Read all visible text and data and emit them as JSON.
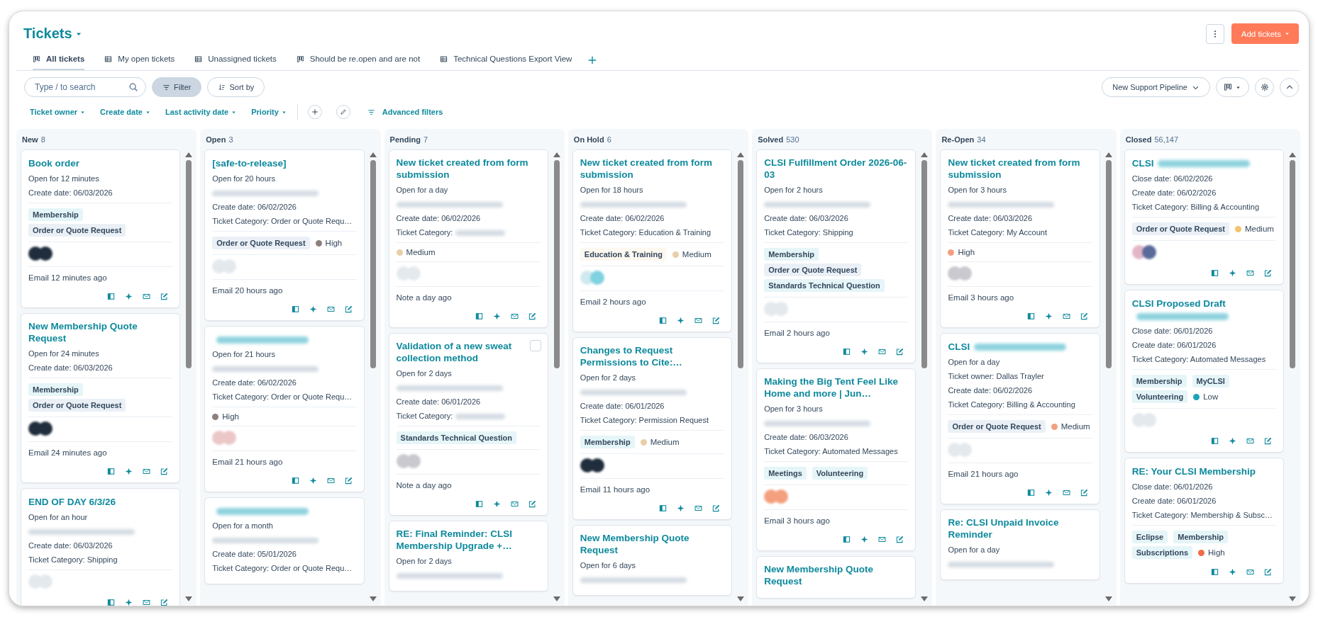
{
  "header": {
    "title": "Tickets",
    "add_button": "Add tickets"
  },
  "tabs": [
    {
      "label": "All tickets",
      "kind": "board",
      "selected": true
    },
    {
      "label": "My open tickets",
      "kind": "table",
      "selected": false
    },
    {
      "label": "Unassigned tickets",
      "kind": "table",
      "selected": false
    },
    {
      "label": "Should be re.open and are not",
      "kind": "board",
      "selected": false
    },
    {
      "label": "Technical Questions Export View",
      "kind": "table",
      "selected": false
    }
  ],
  "toolbar": {
    "search": {
      "placeholder": "Type / to search"
    },
    "filter": {
      "label": "Filter",
      "active": true
    },
    "sort": "Sort by",
    "pipeline": "New Support Pipeline"
  },
  "filters": [
    "Ticket owner",
    "Create date",
    "Last activity date",
    "Priority"
  ],
  "advanced_filters": "Advanced filters",
  "columns": [
    {
      "name": "New",
      "count": "8",
      "cards": [
        {
          "title": "Book order",
          "details": [
            {
              "kind": "text",
              "text": "Open for 12 minutes"
            },
            {
              "kind": "text",
              "text": "Create date: 06/03/2026"
            }
          ],
          "tags": [
            {
              "label": "Membership",
              "color": "#e5f5f8"
            },
            {
              "label": "Order or Quote Request",
              "color": "#eaf0f6"
            }
          ],
          "contact": {
            "kind": "dark"
          },
          "activity": "Email 12 minutes ago"
        },
        {
          "title": "New Membership Quote Request",
          "details": [
            {
              "kind": "text",
              "text": "Open for 24 minutes"
            },
            {
              "kind": "text",
              "text": "Create date: 06/03/2026"
            }
          ],
          "tags": [
            {
              "label": "Membership",
              "color": "#e5f5f8"
            },
            {
              "label": "Order or Quote Request",
              "color": "#eaf0f6"
            }
          ],
          "contact": {
            "kind": "dark"
          },
          "activity": "Email 24 minutes ago"
        },
        {
          "title": "END OF DAY 6/3/26",
          "details": [
            {
              "kind": "text",
              "text": "Open for an hour"
            },
            {
              "kind": "redacted"
            },
            {
              "kind": "text",
              "text": "Create date: 06/03/2026"
            },
            {
              "kind": "text",
              "text": "Ticket Category: Shipping"
            }
          ],
          "contact": {
            "kind": "light"
          }
        }
      ]
    },
    {
      "name": "Open",
      "count": "3",
      "cards": [
        {
          "title": "[safe-to-release]",
          "details": [
            {
              "kind": "text",
              "text": "Open for 20 hours"
            },
            {
              "kind": "redacted"
            },
            {
              "kind": "text",
              "text": "Create date: 06/02/2026"
            },
            {
              "kind": "text",
              "text": "Ticket Category: Order or Quote Requ…"
            }
          ],
          "tags": [
            {
              "label": "Order or Quote Request",
              "color": "#eaf0f6"
            }
          ],
          "priority": {
            "label": "High",
            "color": "#8c8080"
          },
          "contact": {
            "kind": "light"
          },
          "activity": "Email 20 hours ago"
        },
        {
          "title_blur": true,
          "details": [
            {
              "kind": "text",
              "text": "Open for 21 hours"
            },
            {
              "kind": "redacted"
            },
            {
              "kind": "text",
              "text": "Create date: 06/02/2026"
            },
            {
              "kind": "text",
              "text": "Ticket Category: Order or Quote Requ…"
            }
          ],
          "priority": {
            "label": "High",
            "color": "#8c8080"
          },
          "contact": {
            "kind": "pink"
          },
          "activity": "Email 21 hours ago"
        },
        {
          "title_blur": true,
          "details": [
            {
              "kind": "text",
              "text": "Open for a month"
            },
            {
              "kind": "redacted"
            },
            {
              "kind": "text",
              "text": "Create date: 05/01/2026"
            },
            {
              "kind": "text",
              "text": "Ticket Category: Order or Quote Requ…"
            }
          ]
        }
      ]
    },
    {
      "name": "Pending",
      "count": "7",
      "cards": [
        {
          "title": "New ticket created from form submission",
          "details": [
            {
              "kind": "text",
              "text": "Open for a day"
            },
            {
              "kind": "redacted"
            },
            {
              "kind": "text",
              "text": "Create date: 06/02/2026"
            },
            {
              "kind": "partial",
              "text": "Ticket Category:"
            }
          ],
          "priority": {
            "label": "Medium",
            "color": "#e8cfa8"
          },
          "contact": {
            "kind": "light"
          },
          "activity": "Note a day ago"
        },
        {
          "title": "Validation of a new sweat collection method",
          "checked": false,
          "details": [
            {
              "kind": "text",
              "text": "Open for 2 days"
            },
            {
              "kind": "redacted"
            },
            {
              "kind": "text",
              "text": "Create date: 06/01/2026"
            },
            {
              "kind": "partial",
              "text": "Ticket Category:"
            }
          ],
          "tags": [
            {
              "label": "Standards Technical Question",
              "color": "#e5f5f8"
            }
          ],
          "contact": {
            "kind": "grey"
          },
          "activity": "Note a day ago"
        },
        {
          "title": "RE: Final Reminder: CLSI Membership Upgrade +…",
          "details": [
            {
              "kind": "text",
              "text": "Open for 2 days"
            },
            {
              "kind": "redacted"
            }
          ]
        }
      ]
    },
    {
      "name": "On Hold",
      "count": "6",
      "cards": [
        {
          "title": "New ticket created from form submission",
          "details": [
            {
              "kind": "text",
              "text": "Open for 18 hours"
            },
            {
              "kind": "redacted"
            },
            {
              "kind": "text",
              "text": "Create date: 06/02/2026"
            },
            {
              "kind": "text",
              "text": "Ticket Category: Education & Training"
            }
          ],
          "tags": [
            {
              "label": "Education & Training",
              "color": "#fdf8f0"
            }
          ],
          "priority": {
            "label": "Medium",
            "color": "#e8cfa8"
          },
          "contact": {
            "kind": "teal"
          },
          "activity": "Email 2 hours ago"
        },
        {
          "title": "Changes to Request Permissions to Cite:…",
          "details": [
            {
              "kind": "text",
              "text": "Open for 2 days"
            },
            {
              "kind": "redacted"
            },
            {
              "kind": "text",
              "text": "Create date: 06/01/2026"
            },
            {
              "kind": "text",
              "text": "Ticket Category: Permission Request"
            }
          ],
          "tags": [
            {
              "label": "Membership",
              "color": "#e5f5f8"
            }
          ],
          "priority": {
            "label": "Medium",
            "color": "#e8cfa8"
          },
          "contact": {
            "kind": "dark"
          },
          "activity": "Email 11 hours ago"
        },
        {
          "title": "New Membership Quote Request",
          "details": [
            {
              "kind": "text",
              "text": "Open for 6 days"
            },
            {
              "kind": "redacted"
            }
          ]
        }
      ]
    },
    {
      "name": "Solved",
      "count": "530",
      "cards": [
        {
          "title": "CLSI Fulfillment Order 2026-06-03",
          "details": [
            {
              "kind": "text",
              "text": "Open for 2 hours"
            },
            {
              "kind": "redacted"
            },
            {
              "kind": "text",
              "text": "Create date: 06/03/2026"
            },
            {
              "kind": "text",
              "text": "Ticket Category: Shipping"
            }
          ],
          "tags": [
            {
              "label": "Membership",
              "color": "#e5f5f8"
            },
            {
              "label": "Order or Quote Request",
              "color": "#eaf0f6"
            },
            {
              "label": "Standards Technical Question",
              "color": "#e5f5f8"
            }
          ],
          "contact": {
            "kind": "light"
          },
          "activity": "Email 2 hours ago"
        },
        {
          "title": "Making the Big Tent Feel Like Home and more | Jun…",
          "details": [
            {
              "kind": "text",
              "text": "Open for 3 hours"
            },
            {
              "kind": "redacted"
            },
            {
              "kind": "text",
              "text": "Create date: 06/03/2026"
            },
            {
              "kind": "text",
              "text": "Ticket Category: Automated Messages"
            }
          ],
          "tags": [
            {
              "label": "Meetings",
              "color": "#e5f5f8"
            },
            {
              "label": "Volunteering",
              "color": "#e5f5f8"
            }
          ],
          "contact": {
            "kind": "orange"
          },
          "activity": "Email 3 hours ago"
        },
        {
          "title": "New Membership Quote Request"
        }
      ]
    },
    {
      "name": "Re-Open",
      "count": "34",
      "cards": [
        {
          "title": "New ticket created from form submission",
          "details": [
            {
              "kind": "text",
              "text": "Open for 3 hours"
            },
            {
              "kind": "redacted"
            },
            {
              "kind": "text",
              "text": "Create date: 06/03/2026"
            },
            {
              "kind": "text",
              "text": "Ticket Category: My Account"
            }
          ],
          "priority": {
            "label": "High",
            "color": "#f4a07e"
          },
          "contact": {
            "kind": "grey"
          },
          "activity": "Email 3 hours ago"
        },
        {
          "title": "CLSI",
          "title_blur": true,
          "details": [
            {
              "kind": "text",
              "text": "Open for a day"
            },
            {
              "kind": "text",
              "text": "Ticket owner: Dallas Trayler"
            },
            {
              "kind": "text",
              "text": "Create date: 06/02/2026"
            },
            {
              "kind": "text",
              "text": "Ticket Category: Billing & Accounting"
            }
          ],
          "tags": [
            {
              "label": "Order or Quote Request",
              "color": "#eaf0f6"
            }
          ],
          "priority": {
            "label": "Medium",
            "color": "#f4a07e"
          },
          "contact": {
            "kind": "light"
          },
          "activity": "Email 21 hours ago"
        },
        {
          "title": "Re: CLSI Unpaid Invoice Reminder",
          "details": [
            {
              "kind": "text",
              "text": "Open for a day"
            },
            {
              "kind": "redacted"
            }
          ]
        }
      ]
    },
    {
      "name": "Closed",
      "count": "56,147",
      "cards": [
        {
          "title": "CLSI",
          "title_blur": true,
          "details": [
            {
              "kind": "text",
              "text": "Close date: 06/02/2026"
            },
            {
              "kind": "text",
              "text": "Create date: 06/02/2026"
            },
            {
              "kind": "text",
              "text": "Ticket Category: Billing & Accounting"
            }
          ],
          "tags": [
            {
              "label": "Order or Quote Request",
              "color": "#eaf0f6"
            }
          ],
          "priority": {
            "label": "Medium",
            "color": "#f2c46b"
          },
          "contact": {
            "kind": "mixed"
          }
        },
        {
          "title": "CLSI Proposed Draft",
          "title_blur": true,
          "details": [
            {
              "kind": "text",
              "text": "Close date: 06/01/2026"
            },
            {
              "kind": "text",
              "text": "Create date: 06/01/2026"
            },
            {
              "kind": "text",
              "text": "Ticket Category: Automated Messages"
            }
          ],
          "tags": [
            {
              "label": "Membership",
              "color": "#e5f5f8"
            },
            {
              "label": "MyCLSI",
              "color": "#e5f5f8"
            },
            {
              "label": "Volunteering",
              "color": "#e5f5f8"
            }
          ],
          "priority": {
            "label": "Low",
            "color": "#1aa4b8"
          },
          "contact": {
            "kind": "light"
          }
        },
        {
          "title": "RE: Your CLSI Membership",
          "details": [
            {
              "kind": "text",
              "text": "Close date: 06/01/2026"
            },
            {
              "kind": "text",
              "text": "Create date: 06/01/2026"
            },
            {
              "kind": "text",
              "text": "Ticket Category: Membership & Subsc…"
            }
          ],
          "tags": [
            {
              "label": "Eclipse",
              "color": "#e5f5f8"
            },
            {
              "label": "Membership",
              "color": "#e5f5f8"
            },
            {
              "label": "Subscriptions",
              "color": "#e5f5f8"
            }
          ],
          "priority": {
            "label": "High",
            "color": "#f06a4a"
          }
        }
      ]
    }
  ]
}
